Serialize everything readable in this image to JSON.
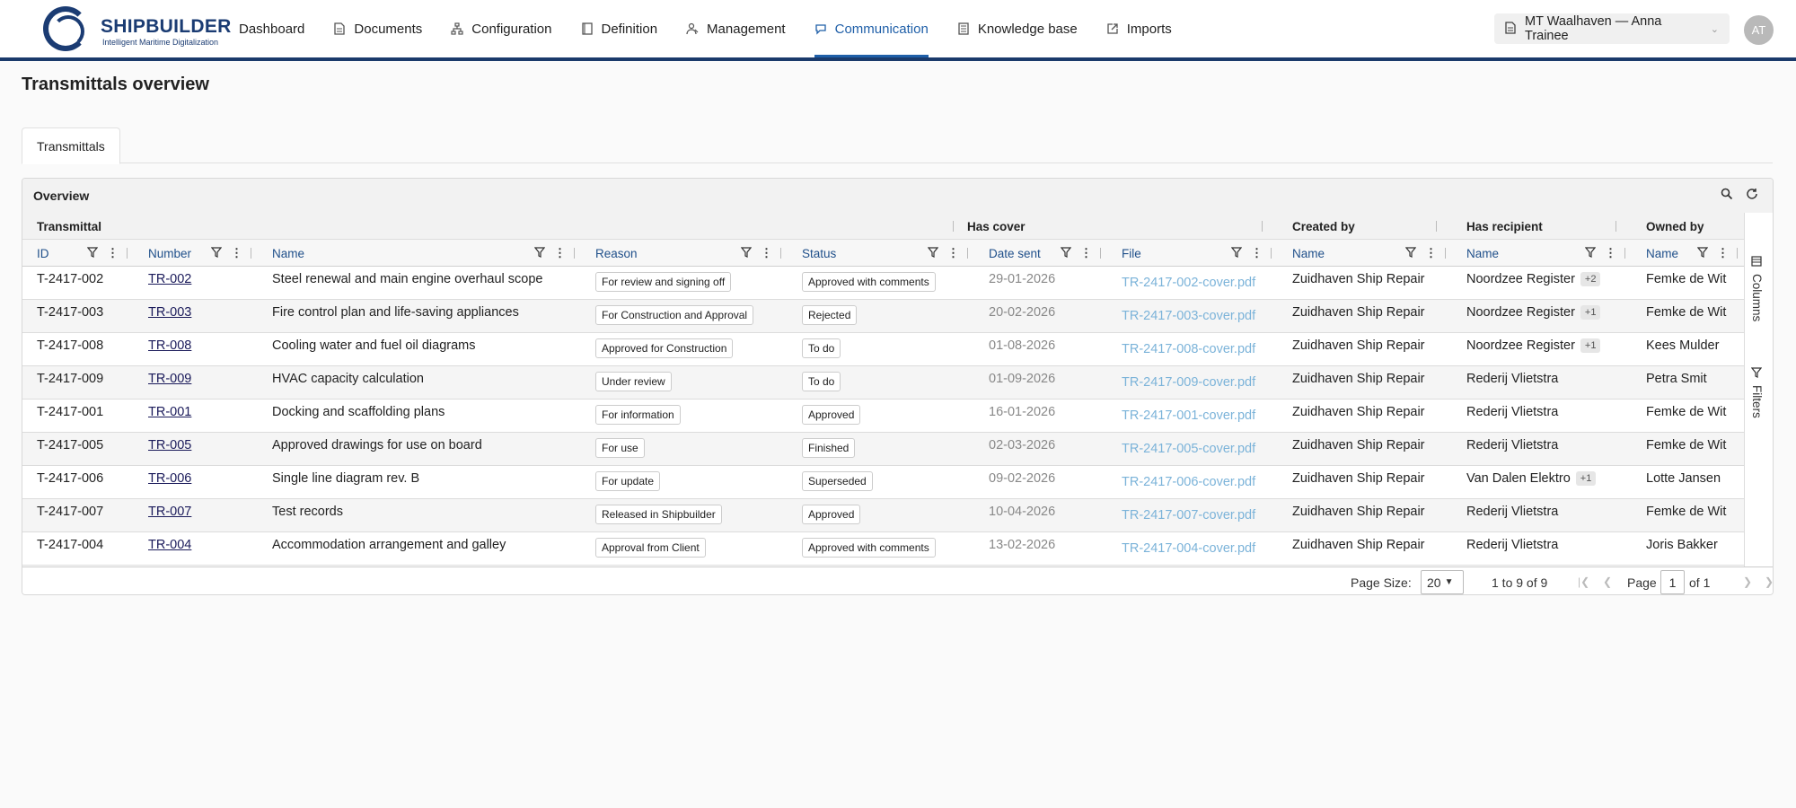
{
  "app": {
    "brand": "SHIPBUILDER",
    "tagline": "Intelligent Maritime Digitalization"
  },
  "nav": [
    {
      "label": "Dashboard",
      "icon": ""
    },
    {
      "label": "Documents",
      "icon": "document-icon"
    },
    {
      "label": "Configuration",
      "icon": "hierarchy-icon"
    },
    {
      "label": "Definition",
      "icon": "page-icon"
    },
    {
      "label": "Management",
      "icon": "users-icon"
    },
    {
      "label": "Communication",
      "icon": "chat-icon",
      "active": true
    },
    {
      "label": "Knowledge base",
      "icon": "book-icon"
    },
    {
      "label": "Imports",
      "icon": "import-icon"
    }
  ],
  "ship_selector": {
    "label": "MT Waalhaven — Anna Trainee"
  },
  "user": {
    "initials": "AT"
  },
  "page": {
    "title": "Transmittals overview"
  },
  "tabs": [
    {
      "label": "Transmittals"
    }
  ],
  "panel": {
    "title": "Overview"
  },
  "groups": {
    "transmittal": "Transmittal",
    "has_cover": "Has cover",
    "created_by": "Created by",
    "has_recipient": "Has recipient",
    "owned_by": "Owned by"
  },
  "columns": [
    "ID",
    "Number",
    "Name",
    "Reason",
    "Status",
    "Date sent",
    "File",
    "Name",
    "Name",
    "Name"
  ],
  "rows": [
    {
      "id": "T-2417-002",
      "number": "TR-002",
      "name": "Steel renewal and main engine overhaul scope",
      "reason": "For review and signing off",
      "status": "Approved with comments",
      "date": "29-01-2026",
      "file": "TR-2417-002-cover.pdf",
      "created": "Zuidhaven Ship Repair",
      "recipient": "Noordzee Register",
      "recipient_more": "+2",
      "owner": "Femke de Wit"
    },
    {
      "id": "T-2417-003",
      "number": "TR-003",
      "name": "Fire control plan and life-saving appliances",
      "reason": "For Construction and Approval",
      "status": "Rejected",
      "date": "20-02-2026",
      "file": "TR-2417-003-cover.pdf",
      "created": "Zuidhaven Ship Repair",
      "recipient": "Noordzee Register",
      "recipient_more": "+1",
      "owner": "Femke de Wit"
    },
    {
      "id": "T-2417-008",
      "number": "TR-008",
      "name": "Cooling water and fuel oil diagrams",
      "reason": "Approved for Construction",
      "status": "To do",
      "date": "01-08-2026",
      "file": "TR-2417-008-cover.pdf",
      "created": "Zuidhaven Ship Repair",
      "recipient": "Noordzee Register",
      "recipient_more": "+1",
      "owner": "Kees Mulder"
    },
    {
      "id": "T-2417-009",
      "number": "TR-009",
      "name": "HVAC capacity calculation",
      "reason": "Under review",
      "status": "To do",
      "date": "01-09-2026",
      "file": "TR-2417-009-cover.pdf",
      "created": "Zuidhaven Ship Repair",
      "recipient": "Rederij Vlietstra",
      "recipient_more": "",
      "owner": "Petra Smit"
    },
    {
      "id": "T-2417-001",
      "number": "TR-001",
      "name": "Docking and scaffolding plans",
      "reason": "For information",
      "status": "Approved",
      "date": "16-01-2026",
      "file": "TR-2417-001-cover.pdf",
      "created": "Zuidhaven Ship Repair",
      "recipient": "Rederij Vlietstra",
      "recipient_more": "",
      "owner": "Femke de Wit"
    },
    {
      "id": "T-2417-005",
      "number": "TR-005",
      "name": "Approved drawings for use on board",
      "reason": "For use",
      "status": "Finished",
      "date": "02-03-2026",
      "file": "TR-2417-005-cover.pdf",
      "created": "Zuidhaven Ship Repair",
      "recipient": "Rederij Vlietstra",
      "recipient_more": "",
      "owner": "Femke de Wit"
    },
    {
      "id": "T-2417-006",
      "number": "TR-006",
      "name": "Single line diagram rev. B",
      "reason": "For update",
      "status": "Superseded",
      "date": "09-02-2026",
      "file": "TR-2417-006-cover.pdf",
      "created": "Zuidhaven Ship Repair",
      "recipient": "Van Dalen Elektro",
      "recipient_more": "+1",
      "owner": "Lotte Jansen"
    },
    {
      "id": "T-2417-007",
      "number": "TR-007",
      "name": "Test records",
      "reason": "Released in Shipbuilder",
      "status": "Approved",
      "date": "10-04-2026",
      "file": "TR-2417-007-cover.pdf",
      "created": "Zuidhaven Ship Repair",
      "recipient": "Rederij Vlietstra",
      "recipient_more": "",
      "owner": "Femke de Wit"
    },
    {
      "id": "T-2417-004",
      "number": "TR-004",
      "name": "Accommodation arrangement and galley",
      "reason": "Approval from Client",
      "status": "Approved with comments",
      "date": "13-02-2026",
      "file": "TR-2417-004-cover.pdf",
      "created": "Zuidhaven Ship Repair",
      "recipient": "Rederij Vlietstra",
      "recipient_more": "",
      "owner": "Joris Bakker"
    }
  ],
  "side_tools": {
    "columns": "Columns",
    "filters": "Filters"
  },
  "pagination": {
    "page_size_label": "Page Size:",
    "page_size": "20",
    "range": "1 to 9 of 9",
    "page_label": "Page",
    "page": "1",
    "of_label": "of 1"
  }
}
